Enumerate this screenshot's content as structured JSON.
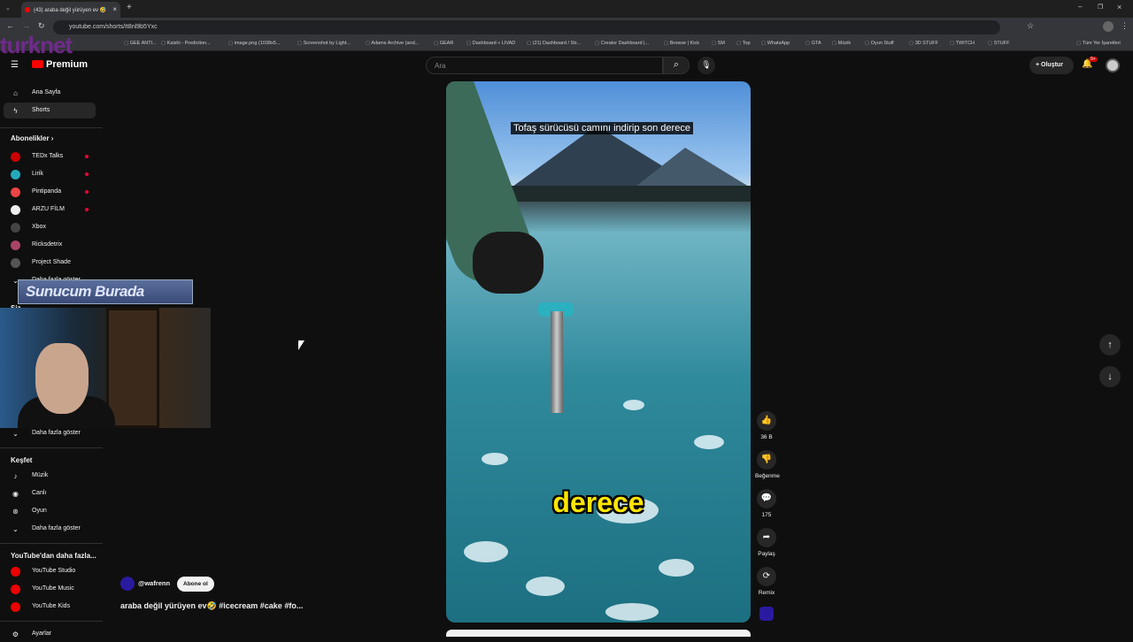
{
  "browser": {
    "tab_title": "(43) araba değil yürüyen ev 🤣",
    "url": "youtube.com/shorts/It8nl9b5Yxc",
    "bookmarks": [
      "GEE ANTI...",
      "Kaishi - Prediction...",
      "image.png (1038x5...",
      "Screenshot by Light...",
      "Adams Archive (and...",
      "GEAR",
      "Dashboard « LIVAD",
      "(21) Dashboard / Str...",
      "Creator Dashboard |...",
      "Browse | Kick",
      "SM",
      "Top",
      "WhatsApp",
      "GTA",
      "Müzik",
      "Oyun Stuff",
      "3D STUFF",
      "TWITCH",
      "STUFF"
    ],
    "other_bookmarks": "Tüm Yer İşaretleri"
  },
  "overlay": {
    "watermark": "turknet",
    "banner": "Sunucum Burada"
  },
  "header": {
    "logo": "Premium",
    "search_placeholder": "Ara",
    "create_label": "Oluştur",
    "notif_count": "9+"
  },
  "sidebar": {
    "home": "Ana Sayfa",
    "shorts": "Shorts",
    "subs_title": "Abonelikler",
    "subs": [
      "TEDx Talks",
      "Lirik",
      "Pintipanda",
      "ARZU FİLM",
      "Xbox",
      "Ricksdetrix",
      "Project Shade"
    ],
    "show_more_1": "Daha fazla göster",
    "you_title": "Siz",
    "show_more_2": "Daha fazla göster",
    "explore_title": "Keşfet",
    "explore": [
      "Müzik",
      "Canlı",
      "Oyun"
    ],
    "show_more_3": "Daha fazla göster",
    "more_title": "YouTube'dan daha fazla...",
    "more": [
      "YouTube Studio",
      "YouTube Music",
      "YouTube Kids"
    ],
    "settings": "Ayarlar"
  },
  "video": {
    "caption_top": "Tofaş sürücüsü camını indirip son derece",
    "caption_big": "derece",
    "channel": "@wafrenn",
    "subscribe": "Abone ol",
    "title": "araba değil yürüyen ev🤣 #icecream  #cake #fo..."
  },
  "actions": {
    "likes": "36 B",
    "dislike": "Beğenme",
    "comments": "175",
    "share": "Paylaş",
    "remix": "Remix"
  }
}
